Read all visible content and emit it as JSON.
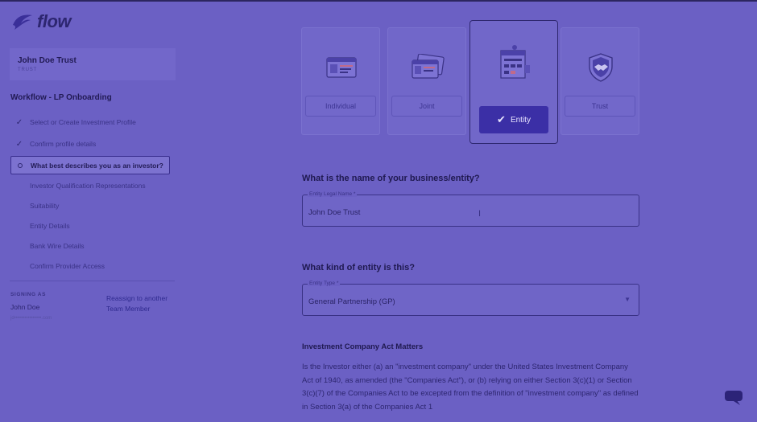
{
  "app": {
    "logo_text": "flow"
  },
  "profile": {
    "name": "John Doe Trust",
    "type": "TRUST"
  },
  "workflow": {
    "title": "Workflow - LP Onboarding",
    "steps": [
      {
        "label": "Select or Create Investment Profile",
        "status": "done"
      },
      {
        "label": "Confirm profile details",
        "status": "done"
      },
      {
        "label": "What best describes you as an investor?",
        "status": "active"
      },
      {
        "label": "Investor Qualification Representations",
        "status": "pending"
      },
      {
        "label": "Suitability",
        "status": "pending"
      },
      {
        "label": "Entity Details",
        "status": "pending"
      },
      {
        "label": "Bank Wire Details",
        "status": "pending"
      },
      {
        "label": "Confirm Provider Access",
        "status": "pending"
      }
    ]
  },
  "signing": {
    "label": "SIGNING AS",
    "name": "John Doe",
    "email": "jd••••••••••••••••.com",
    "reassign_label": "Reassign to another Team Member"
  },
  "investor_types": [
    {
      "label": "Individual",
      "icon": "id-card-icon",
      "selected": false
    },
    {
      "label": "Joint",
      "icon": "two-cards-icon",
      "selected": false
    },
    {
      "label": "Entity",
      "icon": "building-icon",
      "selected": true
    },
    {
      "label": "Trust",
      "icon": "handshake-shield-icon",
      "selected": false
    }
  ],
  "entity_name": {
    "question": "What is the name of your business/entity?",
    "field_label": "Entity Legal Name *",
    "value": "John Doe Trust"
  },
  "entity_type": {
    "question": "What kind of entity is this?",
    "field_label": "Entity Type *",
    "value": "General Partnership (GP)"
  },
  "ica": {
    "title": "Investment Company Act Matters",
    "text": "Is the Investor either (a) an \"investment company\" under the United States Investment Company Act of 1940, as amended (the \"Companies Act\"), or (b) relying on either Section 3(c)(1) or Section 3(c)(7) of the Companies Act to be excepted from the definition of \"investment company\" as defined in Section 3(a) of the Companies Act 1"
  },
  "colors": {
    "overlay": "#6b60c4",
    "accent": "#3b2fa6",
    "text": "#1f1950"
  }
}
